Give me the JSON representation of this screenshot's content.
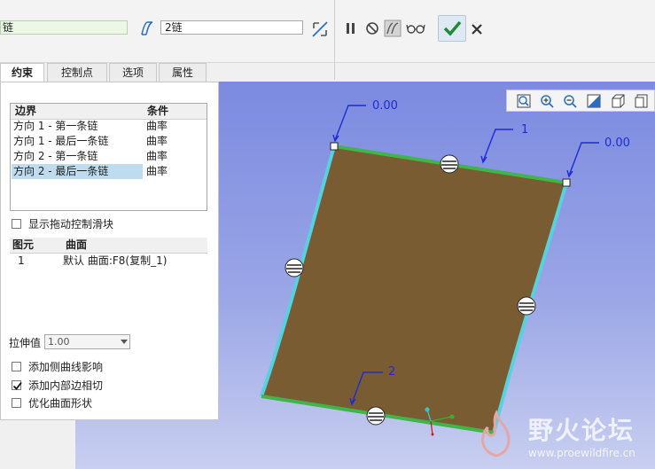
{
  "toolbar": {
    "chain1_value": "链",
    "chain2_value": "2链"
  },
  "tabs": [
    "约束",
    "控制点",
    "选项",
    "属性"
  ],
  "boundary_table": {
    "headers": [
      "边界",
      "条件"
    ],
    "rows": [
      {
        "edge": "方向 1 - 第一条链",
        "condition": "曲率"
      },
      {
        "edge": "方向 1 - 最后一条链",
        "condition": "曲率"
      },
      {
        "edge": "方向 2 - 第一条链",
        "condition": "曲率"
      },
      {
        "edge": "方向 2 - 最后一条链",
        "condition": "曲率"
      }
    ]
  },
  "show_drag_handles_label": "显示拖动控制滑块",
  "element_table": {
    "headers": [
      "图元",
      "曲面"
    ],
    "rows": [
      {
        "id": "1",
        "surface": "默认 曲面:F8(复制_1)"
      }
    ]
  },
  "stretch": {
    "label": "拉伸值",
    "value": "1.00"
  },
  "options": [
    {
      "label": "添加侧曲线影响",
      "checked": false
    },
    {
      "label": "添加内部边相切",
      "checked": true
    },
    {
      "label": "优化曲面形状",
      "checked": false
    }
  ],
  "viewport": {
    "callout_top_left": "0.00",
    "callout_top_mid": "1",
    "callout_right": "0.00",
    "callout_bottom": "2"
  },
  "watermark": {
    "title": "野火论坛",
    "url": "www.proewildfire.cn"
  },
  "colors": {
    "accent_green": "#3fb54a",
    "edge_cyan": "#55d2dd",
    "surface_brown": "#7a5c32",
    "callout_blue": "#1f2bd6",
    "viewport_bg": "#8a97e4"
  }
}
